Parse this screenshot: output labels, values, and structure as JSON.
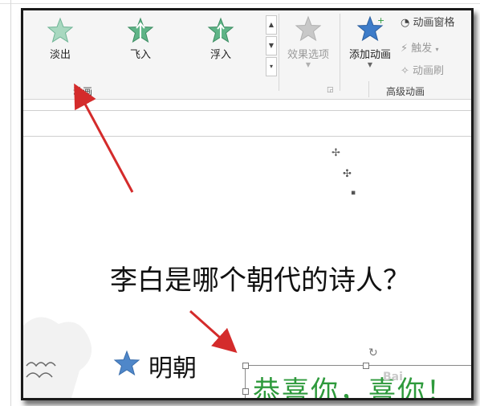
{
  "ribbon": {
    "animations": [
      {
        "label": "淡出",
        "icon": "fade-star-icon"
      },
      {
        "label": "飞入",
        "icon": "fly-in-star-icon"
      },
      {
        "label": "浮入",
        "icon": "float-in-star-icon"
      }
    ],
    "animation_group_label": "动画",
    "effect_options_label": "效果选项",
    "add_animation_label": "添加动画",
    "advanced_group_label": "高级动画",
    "animation_pane_label": "动画窗格",
    "trigger_label": "触发",
    "animation_painter_label": "动画刷"
  },
  "slide": {
    "question": "李白是哪个朝代的诗人？",
    "answer": "明朝",
    "congrats_text": "恭喜你，喜你！"
  },
  "colors": {
    "arrow": "#d42b2b",
    "star_blue": "#4f87c9",
    "green_text": "#2e9a3c"
  }
}
